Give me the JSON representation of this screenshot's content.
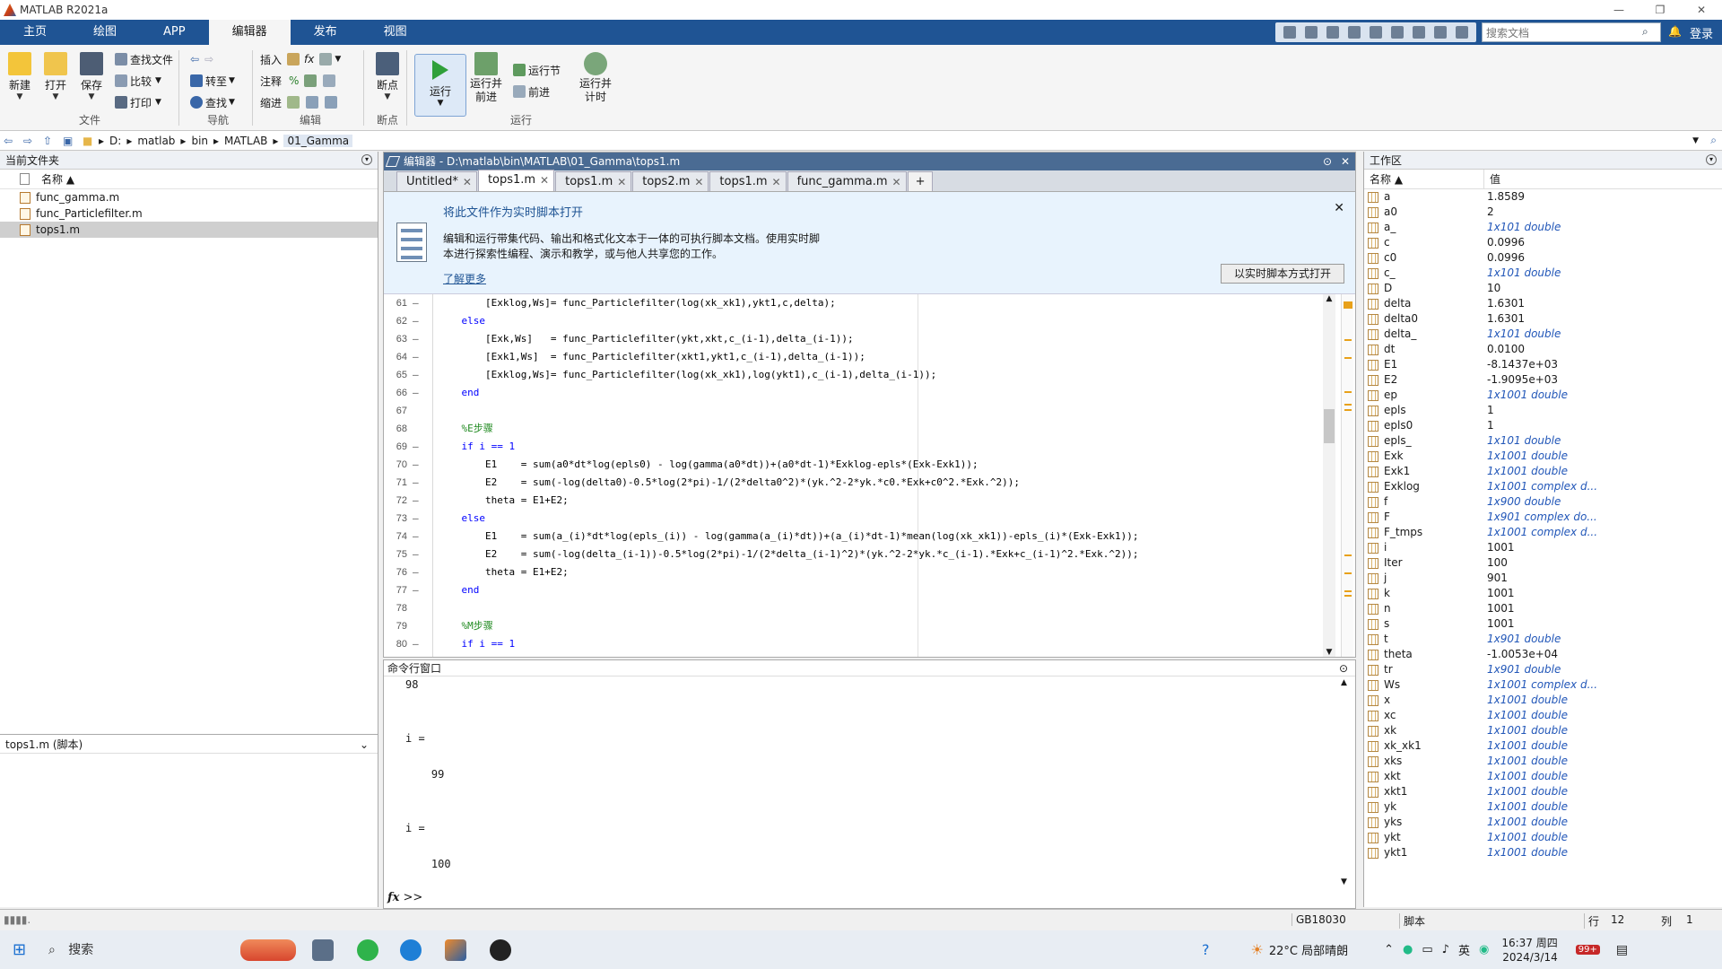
{
  "window": {
    "title": "MATLAB R2021a"
  },
  "ribbon_tabs": [
    "主页",
    "绘图",
    "APP",
    "编辑器",
    "发布",
    "视图"
  ],
  "search": {
    "placeholder": "搜索文档"
  },
  "login": "登录",
  "ribbon": {
    "file": {
      "new": "新建",
      "open": "打开",
      "save": "保存",
      "findfile": "查找文件",
      "compare": "比较",
      "print": "打印",
      "group": "文件"
    },
    "nav": {
      "goto": "转至",
      "find": "查找",
      "group": "导航"
    },
    "edit": {
      "insert": "插入",
      "comment": "注释",
      "indent": "缩进",
      "fx": "fx",
      "pct": "%",
      "group": "编辑"
    },
    "breakpoint": {
      "label": "断点",
      "group": "断点"
    },
    "run": {
      "run": "运行",
      "run_advance": "运行并\n前进",
      "run_section": "运行节",
      "advance": "前进",
      "run_time": "运行并\n计时",
      "group": "运行"
    }
  },
  "address": {
    "crumbs": [
      "D:",
      "matlab",
      "bin",
      "MATLAB",
      "01_Gamma"
    ]
  },
  "current_folder": {
    "title": "当前文件夹",
    "col_name": "名称 ▲",
    "files": [
      {
        "name": "func_gamma.m",
        "selected": false
      },
      {
        "name": "func_Particlefilter.m",
        "selected": false
      },
      {
        "name": "tops1.m",
        "selected": true
      }
    ],
    "detail": "tops1.m  (脚本)"
  },
  "editor": {
    "title": "编辑器 - D:\\matlab\\bin\\MATLAB\\01_Gamma\\tops1.m",
    "tabs": [
      {
        "label": "Untitled*",
        "active": false
      },
      {
        "label": "tops1.m",
        "active": true
      },
      {
        "label": "tops1.m",
        "active": false
      },
      {
        "label": "tops2.m",
        "active": false
      },
      {
        "label": "tops1.m",
        "active": false
      },
      {
        "label": "func_gamma.m",
        "active": false
      }
    ],
    "banner": {
      "title": "将此文件作为实时脚本打开",
      "text": "编辑和运行带集代码、输出和格式化文本于一体的可执行脚本文档。使用实时脚本进行探索性编程、演示和教学，或与他人共享您的工作。",
      "link": "了解更多",
      "button": "以实时脚本方式打开"
    },
    "lines": [
      {
        "n": "61",
        "d": "–",
        "code": "        [Exklog,Ws]= func_Particlefilter(log(xk_xk1),ykt1,c,delta);",
        "type": "plain"
      },
      {
        "n": "62",
        "d": "–",
        "code": "    else",
        "type": "kw"
      },
      {
        "n": "63",
        "d": "–",
        "code": "        [Exk,Ws]   = func_Particlefilter(ykt,xkt,c_(i-1),delta_(i-1));",
        "type": "plain"
      },
      {
        "n": "64",
        "d": "–",
        "code": "        [Exk1,Ws]  = func_Particlefilter(xkt1,ykt1,c_(i-1),delta_(i-1));",
        "type": "plain"
      },
      {
        "n": "65",
        "d": "–",
        "code": "        [Exklog,Ws]= func_Particlefilter(log(xk_xk1),log(ykt1),c_(i-1),delta_(i-1));",
        "type": "plain"
      },
      {
        "n": "66",
        "d": "–",
        "code": "    end",
        "type": "kw"
      },
      {
        "n": "67",
        "d": "",
        "code": "",
        "type": "plain"
      },
      {
        "n": "68",
        "d": "",
        "code": "    %E步骤",
        "type": "cm"
      },
      {
        "n": "69",
        "d": "–",
        "code": "    if i == 1",
        "type": "kw"
      },
      {
        "n": "70",
        "d": "–",
        "code": "        E1    = sum(a0*dt*log(epls0) - log(gamma(a0*dt))+(a0*dt-1)*Exklog-epls*(Exk-Exk1));",
        "type": "plain"
      },
      {
        "n": "71",
        "d": "–",
        "code": "        E2    = sum(-log(delta0)-0.5*log(2*pi)-1/(2*delta0^2)*(yk.^2-2*yk.*c0.*Exk+c0^2.*Exk.^2));",
        "type": "plain"
      },
      {
        "n": "72",
        "d": "–",
        "code": "        theta = E1+E2;",
        "type": "plain"
      },
      {
        "n": "73",
        "d": "–",
        "code": "    else",
        "type": "kw"
      },
      {
        "n": "74",
        "d": "–",
        "code": "        E1    = sum(a_(i)*dt*log(epls_(i)) - log(gamma(a_(i)*dt))+(a_(i)*dt-1)*mean(log(xk_xk1))-epls_(i)*(Exk-Exk1));",
        "type": "plain"
      },
      {
        "n": "75",
        "d": "–",
        "code": "        E2    = sum(-log(delta_(i-1))-0.5*log(2*pi)-1/(2*delta_(i-1)^2)*(yk.^2-2*yk.*c_(i-1).*Exk+c_(i-1)^2.*Exk.^2));",
        "type": "plain"
      },
      {
        "n": "76",
        "d": "–",
        "code": "        theta = E1+E2;",
        "type": "plain"
      },
      {
        "n": "77",
        "d": "–",
        "code": "    end",
        "type": "kw"
      },
      {
        "n": "78",
        "d": "",
        "code": "",
        "type": "plain"
      },
      {
        "n": "79",
        "d": "",
        "code": "    %M步骤",
        "type": "cm"
      },
      {
        "n": "80",
        "d": "–",
        "code": "    if i == 1",
        "type": "kw"
      }
    ]
  },
  "command_window": {
    "title": "命令行窗口",
    "lines": [
      "98",
      "",
      "",
      "i =",
      "",
      "    99",
      "",
      "",
      "i =",
      "",
      "    100"
    ],
    "prompt": ">>"
  },
  "workspace": {
    "title": "工作区",
    "col_name": "名称 ▲",
    "col_value": "值",
    "vars": [
      {
        "n": "a",
        "v": "1.8589",
        "c": false
      },
      {
        "n": "a0",
        "v": "2",
        "c": false
      },
      {
        "n": "a_",
        "v": "1x101 double",
        "c": true
      },
      {
        "n": "c",
        "v": "0.0996",
        "c": false
      },
      {
        "n": "c0",
        "v": "0.0996",
        "c": false
      },
      {
        "n": "c_",
        "v": "1x101 double",
        "c": true
      },
      {
        "n": "D",
        "v": "10",
        "c": false
      },
      {
        "n": "delta",
        "v": "1.6301",
        "c": false
      },
      {
        "n": "delta0",
        "v": "1.6301",
        "c": false
      },
      {
        "n": "delta_",
        "v": "1x101 double",
        "c": true
      },
      {
        "n": "dt",
        "v": "0.0100",
        "c": false
      },
      {
        "n": "E1",
        "v": "-8.1437e+03",
        "c": false
      },
      {
        "n": "E2",
        "v": "-1.9095e+03",
        "c": false
      },
      {
        "n": "ep",
        "v": "1x1001 double",
        "c": true
      },
      {
        "n": "epls",
        "v": "1",
        "c": false
      },
      {
        "n": "epls0",
        "v": "1",
        "c": false
      },
      {
        "n": "epls_",
        "v": "1x101 double",
        "c": true
      },
      {
        "n": "Exk",
        "v": "1x1001 double",
        "c": true
      },
      {
        "n": "Exk1",
        "v": "1x1001 double",
        "c": true
      },
      {
        "n": "Exklog",
        "v": "1x1001 complex d...",
        "c": true
      },
      {
        "n": "f",
        "v": "1x900 double",
        "c": true
      },
      {
        "n": "F",
        "v": "1x901 complex do...",
        "c": true
      },
      {
        "n": "F_tmps",
        "v": "1x1001 complex d...",
        "c": true
      },
      {
        "n": "i",
        "v": "1001",
        "c": false
      },
      {
        "n": "Iter",
        "v": "100",
        "c": false
      },
      {
        "n": "j",
        "v": "901",
        "c": false
      },
      {
        "n": "k",
        "v": "1001",
        "c": false
      },
      {
        "n": "n",
        "v": "1001",
        "c": false
      },
      {
        "n": "s",
        "v": "1001",
        "c": false
      },
      {
        "n": "t",
        "v": "1x901 double",
        "c": true
      },
      {
        "n": "theta",
        "v": "-1.0053e+04",
        "c": false
      },
      {
        "n": "tr",
        "v": "1x901 double",
        "c": true
      },
      {
        "n": "Ws",
        "v": "1x1001 complex d...",
        "c": true
      },
      {
        "n": "x",
        "v": "1x1001 double",
        "c": true
      },
      {
        "n": "xc",
        "v": "1x1001 double",
        "c": true
      },
      {
        "n": "xk",
        "v": "1x1001 double",
        "c": true
      },
      {
        "n": "xk_xk1",
        "v": "1x1001 double",
        "c": true
      },
      {
        "n": "xks",
        "v": "1x1001 double",
        "c": true
      },
      {
        "n": "xkt",
        "v": "1x1001 double",
        "c": true
      },
      {
        "n": "xkt1",
        "v": "1x1001 double",
        "c": true
      },
      {
        "n": "yk",
        "v": "1x1001 double",
        "c": true
      },
      {
        "n": "yks",
        "v": "1x1001 double",
        "c": true
      },
      {
        "n": "ykt",
        "v": "1x1001 double",
        "c": true
      },
      {
        "n": "ykt1",
        "v": "1x1001 double",
        "c": true
      }
    ]
  },
  "status": {
    "encoding": "GB18030",
    "mode": "脚本",
    "row_label": "行",
    "row": "12",
    "col_label": "列",
    "col": "1"
  },
  "taskbar": {
    "search": "搜索",
    "weather": "22°C  局部晴朗",
    "ime": "英",
    "time": "16:37 周四",
    "date": "2024/3/14",
    "badge": "99+"
  }
}
